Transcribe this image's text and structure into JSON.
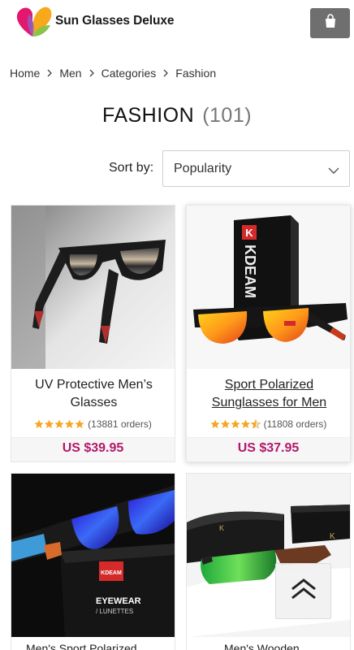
{
  "header": {
    "brand": "Sun Glasses Deluxe",
    "logo_icon": "heart-leaf-logo",
    "cart_icon": "shopping-bag-icon"
  },
  "breadcrumb": [
    "Home",
    "Men",
    "Categories",
    "Fashion"
  ],
  "page_title": {
    "title": "FASHION",
    "count": "(101)"
  },
  "sort": {
    "label": "Sort by:",
    "selected": "Popularity"
  },
  "products": [
    {
      "name": "UV Protective Men’s Glasses",
      "rating": 5,
      "orders": "(13881 orders)",
      "price": "US $39.95"
    },
    {
      "name": "Sport Polarized Sunglasses for Men",
      "rating": 4.5,
      "orders": "(11808 orders)",
      "price": "US $37.95"
    },
    {
      "name": "Men's Sport Polarized",
      "partial": true
    },
    {
      "name": "Men's Wooden",
      "partial": true
    }
  ],
  "colors": {
    "price": "#b3186a",
    "star": "#f5a623",
    "cart_button": "#6f6f6f"
  }
}
